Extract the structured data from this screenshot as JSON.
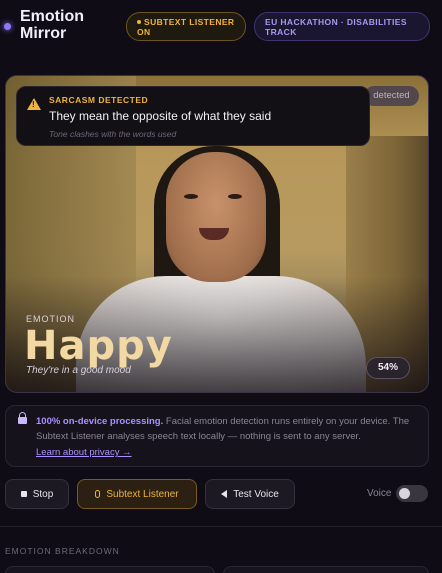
{
  "header": {
    "brand": "Emotion Mirror",
    "listener_badge": "SUBTEXT LISTENER ON",
    "track_badge": "EU HACKATHON · DISABILITIES TRACK"
  },
  "video": {
    "detected_chip": "detected",
    "alert": {
      "title": "SARCASM DETECTED",
      "message": "They mean the opposite of what they said",
      "sub": "Tone clashes with the words used"
    },
    "emotion": {
      "label": "EMOTION",
      "name": "Happy",
      "caption": "They're in a good mood",
      "confidence": "54%"
    }
  },
  "privacy": {
    "strong": "100% on-device processing.",
    "text": " Facial emotion detection runs entirely on your device. The Subtext Listener analyses speech text locally — nothing is sent to any server.",
    "link": "Learn about privacy →"
  },
  "controls": {
    "stop": "Stop",
    "listener": "Subtext Listener",
    "test_voice": "Test Voice",
    "voice_label": "Voice",
    "voice_on": false
  },
  "breakdown": {
    "title": "EMOTION BREAKDOWN"
  },
  "colors": {
    "accent": "#8d77ff",
    "warning": "#f0b33b",
    "emotion": "#f2d8a2"
  }
}
